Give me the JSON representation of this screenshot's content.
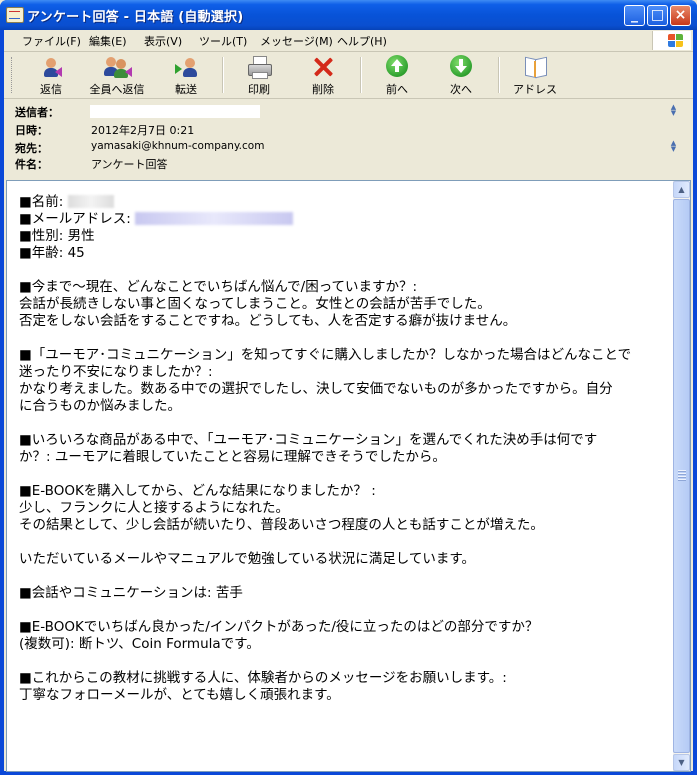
{
  "window": {
    "title": "アンケート回答 - 日本語 (自動選択)",
    "minimize": "_",
    "maximize": "□",
    "close": "×"
  },
  "menu": [
    "ファイル(F)",
    "編集(E)",
    "表示(V)",
    "ツール(T)",
    "メッセージ(M)",
    "ヘルプ(H)"
  ],
  "toolbar": {
    "reply": "返信",
    "reply_all": "全員へ返信",
    "forward": "転送",
    "print": "印刷",
    "delete": "削除",
    "prev": "前へ",
    "next": "次へ",
    "address": "アドレス"
  },
  "header": {
    "from_label": "送信者：",
    "date_label": "日時：",
    "date_value": "2012年2月7日 0:21",
    "to_label": "宛先：",
    "to_value": "yamasaki@khnum-company.com",
    "subject_label": "件名：",
    "subject_value": "アンケート回答"
  },
  "body": {
    "name_label": "■名前: ",
    "email_label": "■メールアドレス: ",
    "gender": "■性別: 男性",
    "age": "■年齢: 45",
    "q1": "■今まで～現在、どんなことでいちばん悩んで/困っていますか？:",
    "a1_1": "会話が長続きしない事と固くなってしまうこと。女性との会話が苦手でした。",
    "a1_2": "否定をしない会話をすることですね。どうしても、人を否定する癖が抜けません。",
    "q2_1": "■「ユーモア･コミュニケーション」を知ってすぐに購入しましたか？しなかった場合はどんなことで",
    "q2_2": "迷ったり不安になりましたか？:",
    "a2_1": "かなり考えました。数ある中での選択でしたし、決して安価でないものが多かったですから。自分",
    "a2_2": "に合うものか悩みました。",
    "q3_1": "■いろいろな商品がある中で、「ユーモア･コミュニケーション」を選んでくれた決め手は何です",
    "q3_2": "か？: ユーモアに着眼していたことと容易に理解できそうでしたから。",
    "q4": "■E-BOOKを購入してから、どんな結果になりましたか？ :",
    "a4_1": "少し、フランクに人と接するようになれた。",
    "a4_2": "その結果として、少し会話が続いたり、普段あいさつ程度の人とも話すことが増えた。",
    "satisfaction": "いただいているメールやマニュアルで勉強している状況に満足しています。",
    "q5": "■会話やコミュニケーションは: 苦手",
    "q6_1": "■E-BOOKでいちばん良かった/インパクトがあった/役に立ったのはどの部分ですか？",
    "q6_2": "(複数可): 断トツ、Coin Formulaです。",
    "q7": "■これからこの教材に挑戦する人に、体験者からのメッセージをお願いします。:",
    "a7": "丁寧なフォローメールが、とても嬉しく頑張れます。"
  },
  "colors": {
    "titlebar": "#0a4fd0",
    "chrome": "#ece9d8",
    "prev_arrow": "#2fa12f",
    "next_arrow": "#2fa12f",
    "delete_x": "#d42a1a"
  }
}
